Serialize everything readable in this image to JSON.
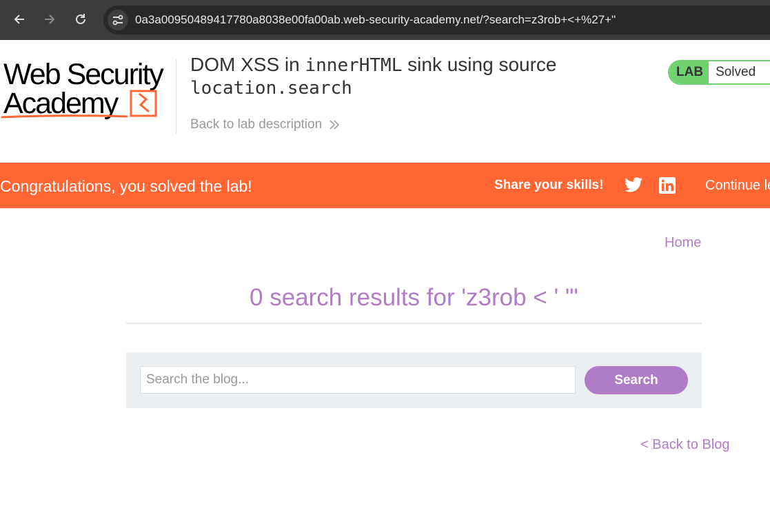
{
  "browser": {
    "url": "0a3a00950489417780a8038e00fa00ab.web-security-academy.net/?search=z3rob+<+%27+\"",
    "back_icon": "arrow-left-icon",
    "forward_icon": "arrow-right-icon",
    "reload_icon": "reload-icon",
    "site_info_icon": "tune-icon"
  },
  "header": {
    "logo_text": "Web Security Academy",
    "lab_title_prefix": "DOM XSS in ",
    "lab_title_code1": "innerHTML",
    "lab_title_middle": " sink using source",
    "lab_title_code2": "location.search",
    "back_to_description": "Back to lab description",
    "badge_label": "LAB",
    "badge_status": "Solved"
  },
  "banner": {
    "message": "Congratulations, you solved the lab!",
    "share_label": "Share your skills!",
    "twitter_icon": "twitter-icon",
    "linkedin_icon": "linkedin-icon",
    "continue_label": "Continue le"
  },
  "content": {
    "home_link": "Home",
    "results_heading": "0 search results for 'z3rob < ' \"'",
    "search_placeholder": "Search the blog...",
    "search_button": "Search",
    "back_to_blog": "< Back to Blog"
  },
  "colors": {
    "accent_purple": "#b07cc6",
    "banner_orange": "#ff6633",
    "solved_green": "#70d16f",
    "chrome_dark": "#3c3c3c"
  }
}
